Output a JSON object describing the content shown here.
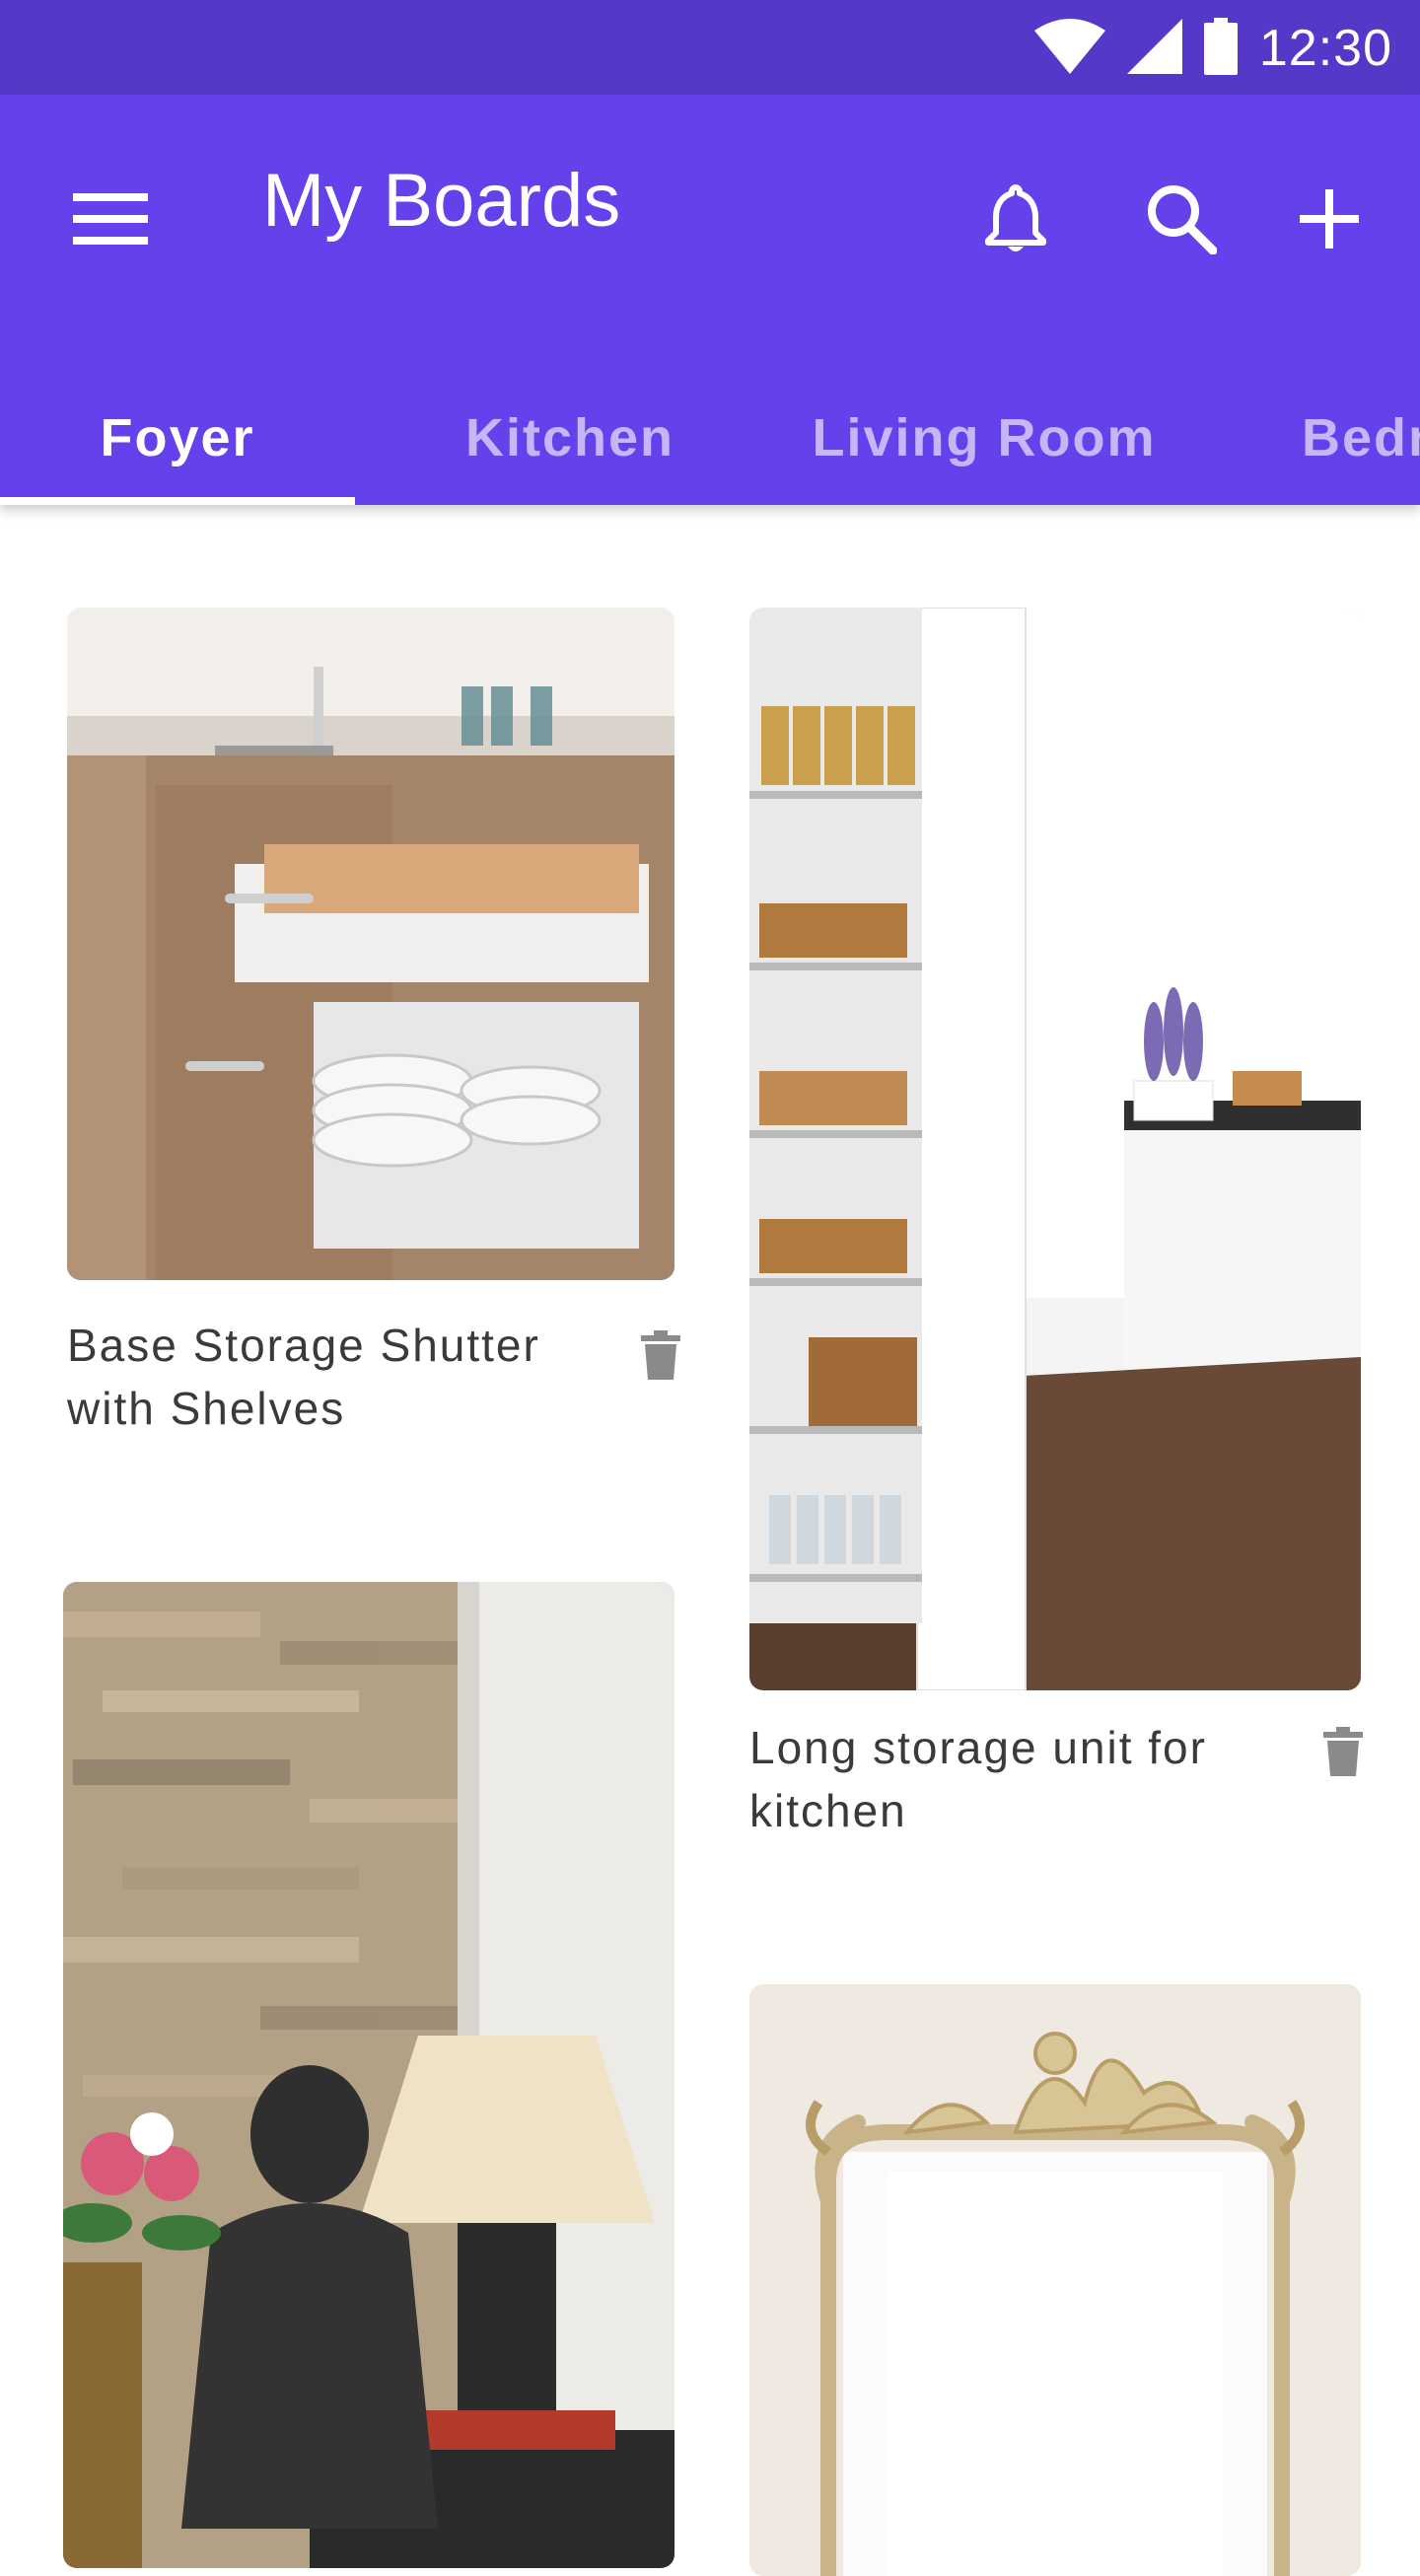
{
  "status_bar": {
    "time": "12:30",
    "icons": [
      "wifi-icon",
      "signal-icon",
      "battery-icon"
    ]
  },
  "app_bar": {
    "title": "My Boards",
    "actions": [
      "menu-icon",
      "bell-icon",
      "search-icon",
      "add-icon"
    ]
  },
  "tabs": [
    {
      "label": "Foyer",
      "active": true
    },
    {
      "label": "Kitchen",
      "active": false
    },
    {
      "label": "Living Room",
      "active": false
    },
    {
      "label": "Bedr",
      "active": false
    }
  ],
  "cards": [
    {
      "caption": "Base Storage Shutter with Shelves",
      "action_icon": "trash-icon"
    },
    {
      "caption": "Long storage unit for kitchen",
      "action_icon": "trash-icon"
    },
    {
      "caption": "",
      "action_icon": ""
    },
    {
      "caption": "",
      "action_icon": ""
    }
  ],
  "colors": {
    "status_bar": "#5538C8",
    "primary": "#6441EA",
    "tab_inactive": "rgba(255,255,255,0.62)",
    "caption_text": "#3a3a3a",
    "icon_grey": "#8a8a8a"
  }
}
